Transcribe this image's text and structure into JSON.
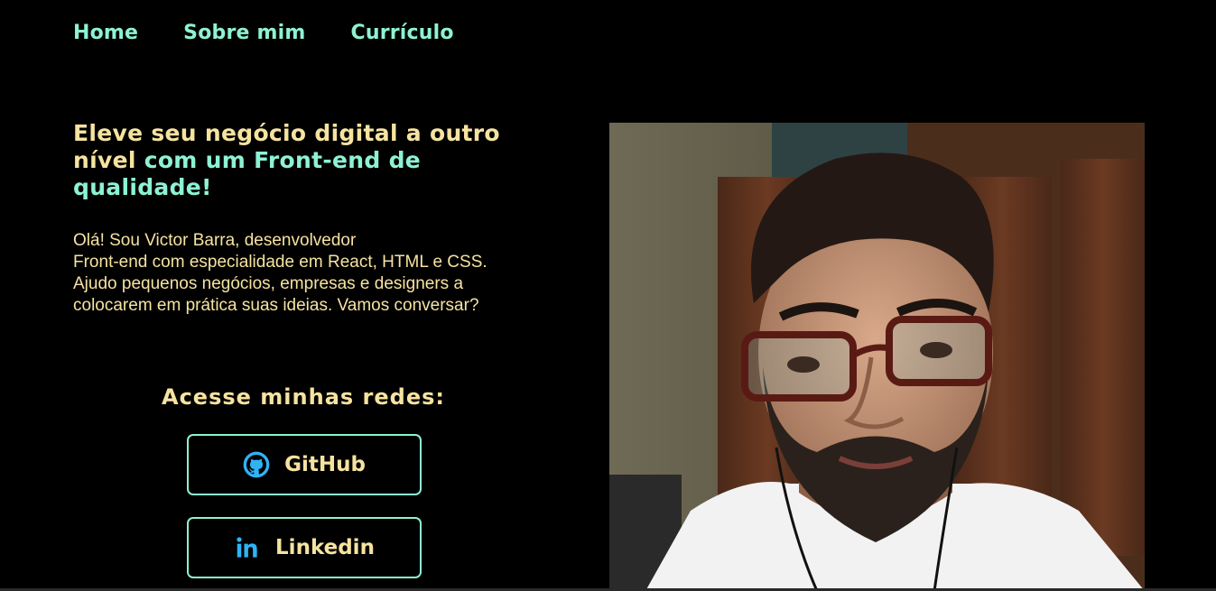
{
  "nav": {
    "items": [
      {
        "label": "Home"
      },
      {
        "label": "Sobre mim"
      },
      {
        "label": "Currículo"
      }
    ]
  },
  "hero": {
    "headline_part1": "Eleve seu negócio digital a outro nível",
    "headline_part2": " com um Front-end de qualidade!",
    "intro_lines": [
      "Olá! Sou Victor Barra, desenvolvedor",
      "Front-end com especialidade em React, HTML e CSS. Ajudo pequenos negócios, empresas e designers a",
      "colocarem em prática suas ideias. Vamos conversar?"
    ]
  },
  "social": {
    "title": "Acesse minhas redes:",
    "buttons": [
      {
        "label": "GitHub",
        "icon": "github-icon"
      },
      {
        "label": "Linkedin",
        "icon": "linkedin-icon"
      }
    ]
  },
  "colors": {
    "background": "#000000",
    "accent_green": "#8ef2d4",
    "accent_yellow": "#f6e3a0",
    "icon_blue": "#2fb3f5"
  }
}
